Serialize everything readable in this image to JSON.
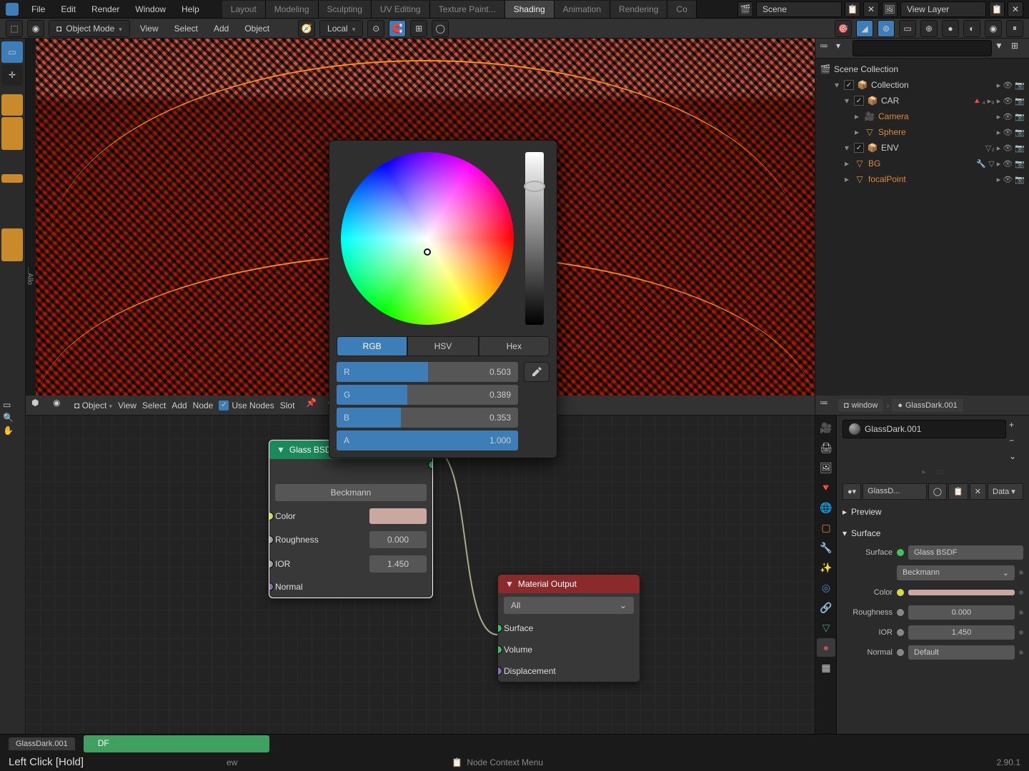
{
  "top_menu": {
    "items": [
      "File",
      "Edit",
      "Render",
      "Window",
      "Help"
    ],
    "workspaces": [
      "Layout",
      "Modeling",
      "Sculpting",
      "UV Editing",
      "Texture Paint...",
      "Shading",
      "Animation",
      "Rendering",
      "Co"
    ],
    "active_workspace": "Shading",
    "scene_label": "Scene",
    "layer_label": "View Layer"
  },
  "viewport_header": {
    "mode": "Object Mode",
    "menus": [
      "View",
      "Select",
      "Add",
      "Object"
    ],
    "orientation": "Local"
  },
  "outliner": {
    "search_placeholder": "",
    "root": "Scene Collection",
    "items": [
      {
        "indent": 1,
        "check": true,
        "icon": "📦",
        "label": "Collection",
        "right": "▸ 👁 📷"
      },
      {
        "indent": 2,
        "check": true,
        "icon": "📦",
        "label": "CAR",
        "right": "🔺₄ ▸₉ ▸ 👁 📷"
      },
      {
        "indent": 3,
        "check": false,
        "icon": "🎥",
        "label": "Camera",
        "color": "#d98a3a",
        "right": "▸ 👁 📷"
      },
      {
        "indent": 3,
        "check": false,
        "icon": "▽",
        "label": "Sphere",
        "color": "#d98a3a",
        "right": "▸ 👁 📷"
      },
      {
        "indent": 2,
        "check": true,
        "icon": "📦",
        "label": "ENV",
        "right": "▽₂ ▸ 👁 📷"
      },
      {
        "indent": 2,
        "check": false,
        "icon": "▽",
        "label": "BG",
        "color": "#d98a3a",
        "right": "🔧 ▽ ▸ 👁 📷"
      },
      {
        "indent": 2,
        "check": false,
        "icon": "▽",
        "label": "focalPoint",
        "color": "#d98a3a",
        "right": "▸ 👁 📷"
      }
    ]
  },
  "node_editor": {
    "mode": "Object",
    "menus": [
      "View",
      "Select",
      "Add",
      "Node"
    ],
    "use_nodes": "Use Nodes",
    "slot": "Slot"
  },
  "glass_node": {
    "title": "Glass BSDF",
    "distribution": "Beckmann",
    "color_label": "Color",
    "roughness_label": "Roughness",
    "roughness_value": "0.000",
    "ior_label": "IOR",
    "ior_value": "1.450",
    "normal_label": "Normal"
  },
  "output_node": {
    "title": "Material Output",
    "target": "All",
    "surface": "Surface",
    "volume": "Volume",
    "displacement": "Displacement"
  },
  "color_picker": {
    "tabs": [
      "RGB",
      "HSV",
      "Hex"
    ],
    "active_tab": "RGB",
    "channels": [
      {
        "label": "R",
        "value": "0.503",
        "fill": 50.3
      },
      {
        "label": "G",
        "value": "0.389",
        "fill": 38.9
      },
      {
        "label": "B",
        "value": "0.353",
        "fill": 35.3
      },
      {
        "label": "A",
        "value": "1.000",
        "fill": 100
      }
    ]
  },
  "properties": {
    "breadcrumb": [
      "window",
      "GlassDark.001"
    ],
    "material_name": "GlassDark.001",
    "material_short": "GlassD...",
    "data_link": "Data",
    "preview": "Preview",
    "surface": "Surface",
    "surface_label": "Surface",
    "surface_value": "Glass BSDF",
    "distribution": "Beckmann",
    "color_label": "Color",
    "roughness_label": "Roughness",
    "roughness_value": "0.000",
    "ior_label": "IOR",
    "ior_value": "1.450",
    "normal_label": "Normal",
    "normal_value": "Default"
  },
  "status": {
    "tab_name": "GlassDark.001",
    "green_suffix": "DF",
    "hint": "Left Click [Hold]",
    "context_menu": "Node Context Menu",
    "version": "2.90.1",
    "ew": "ew"
  },
  "left_collapse": "...Allo"
}
